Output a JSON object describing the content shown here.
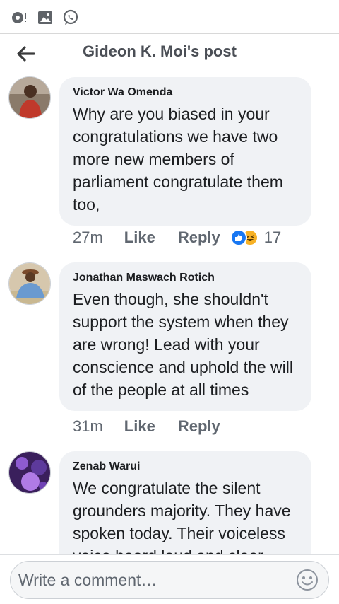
{
  "status_bar": {
    "icons": [
      "wifi-signal-icon",
      "image-icon",
      "whatsapp-icon"
    ]
  },
  "header": {
    "title": "Gideon K. Moi's post",
    "back_icon": "arrow-left-icon"
  },
  "comments": [
    {
      "author": "Victor Wa Omenda",
      "text": "Why are you biased in your congratulations we have two more new members of parliament congratulate them too,",
      "time": "27m",
      "like_label": "Like",
      "reply_label": "Reply",
      "reactions": [
        "like",
        "haha"
      ],
      "reaction_count": "17"
    },
    {
      "author": "Jonathan Maswach Rotich",
      "text": "Even though, she shouldn't support the system when they are wrong! Lead with your conscience and uphold the will of the people at all times",
      "time": "31m",
      "like_label": "Like",
      "reply_label": "Reply"
    },
    {
      "author": "Zenab Warui",
      "text": "We congratulate the silent grounders majority. They have spoken today. Their voiceless voice heard loud and clear"
    }
  ],
  "composer": {
    "placeholder": "Write a comment…",
    "emoji_icon": "emoji-smiley-icon"
  },
  "colors": {
    "bubble": "#f0f2f5",
    "link_blue": "#1877f2",
    "haha_yellow": "#f7b125",
    "meta_gray": "#606770"
  }
}
